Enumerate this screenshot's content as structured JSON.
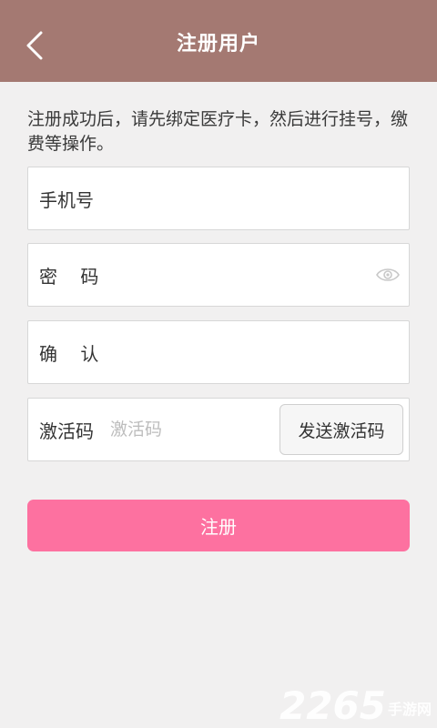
{
  "header": {
    "title": "注册用户",
    "back_icon": "chevron-left-icon"
  },
  "intro_text": "注册成功后，请先绑定医疗卡，然后进行挂号，缴费等操作。",
  "form": {
    "phone": {
      "label": "手机号",
      "value": "",
      "placeholder": ""
    },
    "password": {
      "label": "密    码",
      "value": "",
      "placeholder": "",
      "toggle_icon": "eye-icon"
    },
    "confirm": {
      "label": "确    认",
      "value": "",
      "placeholder": ""
    },
    "activation": {
      "label": "激活码",
      "value": "",
      "placeholder": "激活码",
      "send_label": "发送激活码"
    }
  },
  "register_label": "注册",
  "watermark": {
    "logo": "2265",
    "text": "手游网"
  },
  "colors": {
    "header_bg": "#a47972",
    "page_bg": "#f1f0f0",
    "register_bg": "#fd71a0",
    "border": "#d7d7d7"
  }
}
